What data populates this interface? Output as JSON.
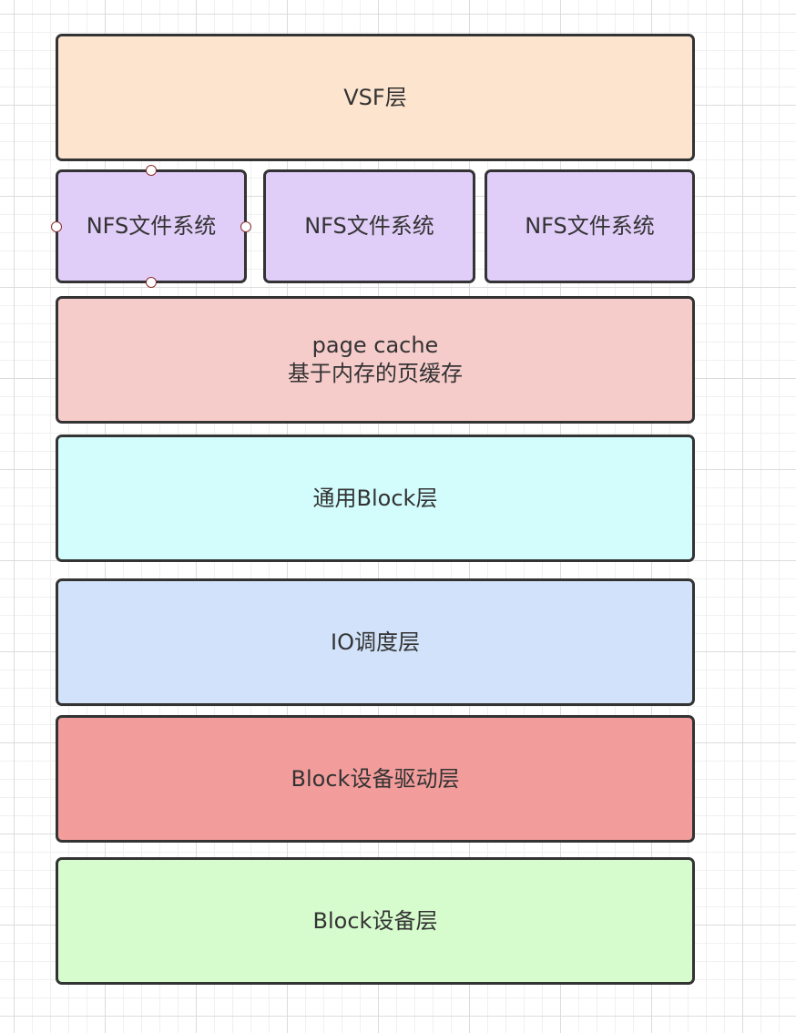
{
  "diagram": {
    "layers": {
      "vfs": {
        "label": "VSF层",
        "color": "#fce4cf"
      },
      "nfs": [
        {
          "label": "NFS文件系统",
          "color": "#e0cdf8",
          "selected": true
        },
        {
          "label": "NFS文件系统",
          "color": "#e0cdf8",
          "selected": false
        },
        {
          "label": "NFS文件系统",
          "color": "#e0cdf8",
          "selected": false
        }
      ],
      "page_cache": {
        "line1": "page cache",
        "line2": "基于内存的页缓存",
        "color": "#f6cccb"
      },
      "generic_block": {
        "label": "通用Block层",
        "color": "#d3fdfd"
      },
      "io_scheduler": {
        "label": "IO调度层",
        "color": "#d1e2fa"
      },
      "block_driver": {
        "label": "Block设备驱动层",
        "color": "#f29d9b"
      },
      "block_device": {
        "label": "Block设备层",
        "color": "#d6fcce"
      }
    }
  }
}
